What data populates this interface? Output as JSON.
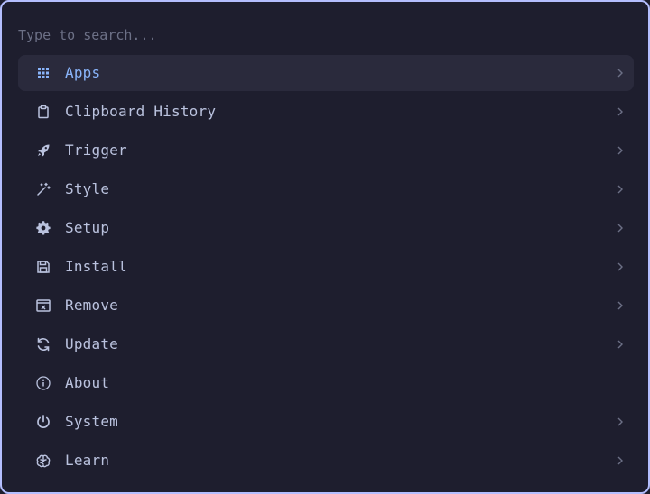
{
  "search": {
    "placeholder": "Type to search...",
    "value": ""
  },
  "colors": {
    "accent": "#89b4fa",
    "text": "#bac2de",
    "border": "#b4befe",
    "background": "#1e1e2e",
    "selected_bg": "#2a2a3c"
  },
  "menu": {
    "items": [
      {
        "label": "Apps",
        "icon": "grid-icon",
        "has_submenu": true,
        "selected": true
      },
      {
        "label": "Clipboard History",
        "icon": "clipboard-icon",
        "has_submenu": true
      },
      {
        "label": "Trigger",
        "icon": "rocket-icon",
        "has_submenu": true
      },
      {
        "label": "Style",
        "icon": "magic-wand-icon",
        "has_submenu": true
      },
      {
        "label": "Setup",
        "icon": "gear-icon",
        "has_submenu": true
      },
      {
        "label": "Install",
        "icon": "floppy-disk-icon",
        "has_submenu": true
      },
      {
        "label": "Remove",
        "icon": "window-close-icon",
        "has_submenu": true
      },
      {
        "label": "Update",
        "icon": "refresh-icon",
        "has_submenu": true
      },
      {
        "label": "About",
        "icon": "info-icon",
        "has_submenu": false
      },
      {
        "label": "System",
        "icon": "power-icon",
        "has_submenu": true
      },
      {
        "label": "Learn",
        "icon": "brain-icon",
        "has_submenu": true
      }
    ]
  }
}
